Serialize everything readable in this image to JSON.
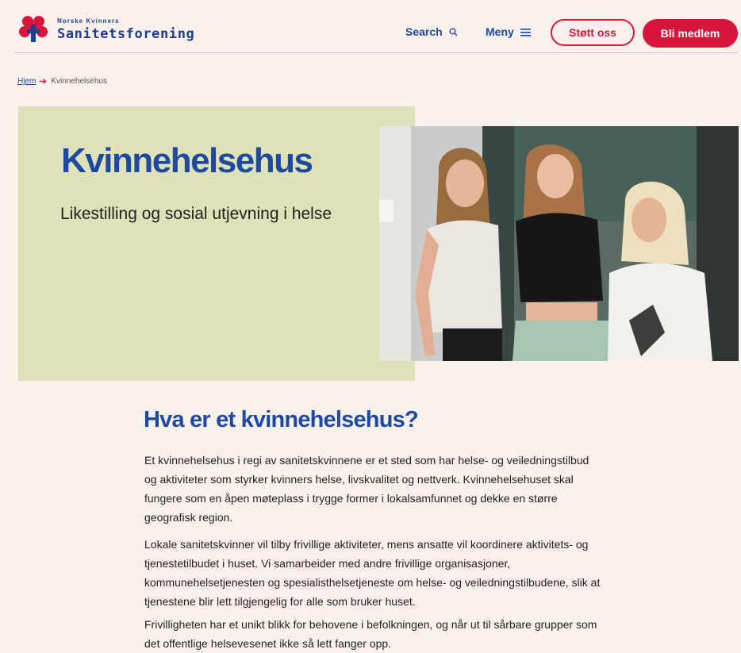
{
  "brand": {
    "org_line": "Norske Kvinners",
    "name": "Sanitetsforening"
  },
  "nav": {
    "search_label": "Search",
    "menu_label": "Meny",
    "support_label": "Støtt oss",
    "join_label": "Bli medlem"
  },
  "icons": {
    "logo": "shamrock-cross-logo",
    "search": "search-icon",
    "menu": "hamburger-menu-icon",
    "breadcrumb_separator": "arrow-right-icon"
  },
  "colors": {
    "brand_blue": "#1d4aa0",
    "accent_red": "#d8163a",
    "page_background": "#fbf1ec",
    "hero_panel": "#dfe2b8"
  },
  "breadcrumb": {
    "home": "Hjem",
    "current": "Kvinnehelsehus"
  },
  "hero": {
    "title": "Kvinnehelsehus",
    "subtitle": "Likestilling og sosial utjevning i helse"
  },
  "article": {
    "heading": "Hva er et kvinnehelsehus?",
    "paragraphs": [
      "Et kvinnehelsehus i regi av sanitetskvinnene er et sted som har helse- og veiledningstilbud og aktiviteter som styrker kvinners helse, livskvalitet og nettverk. Kvinnehelsehuset skal fungere som en åpen møteplass i trygge former i lokalsamfunnet og dekke en større geografisk region.",
      "Lokale sanitetskvinner vil tilby frivillige aktiviteter, mens ansatte vil koordinere aktivitets- og tjenestetilbudet i huset. Vi samarbeider med andre frivillige organisasjoner, kommunehelsetjenesten og spesialisthelsetjeneste om helse- og veiledningstilbudene, slik at tjenestene blir lett tilgjengelig for alle som bruker huset.",
      "Frivilligheten har et unikt blikk for behovene i befolkningen, og når ut til sårbare grupper som det offentlige helsevesenet ikke så lett fanger opp."
    ]
  }
}
